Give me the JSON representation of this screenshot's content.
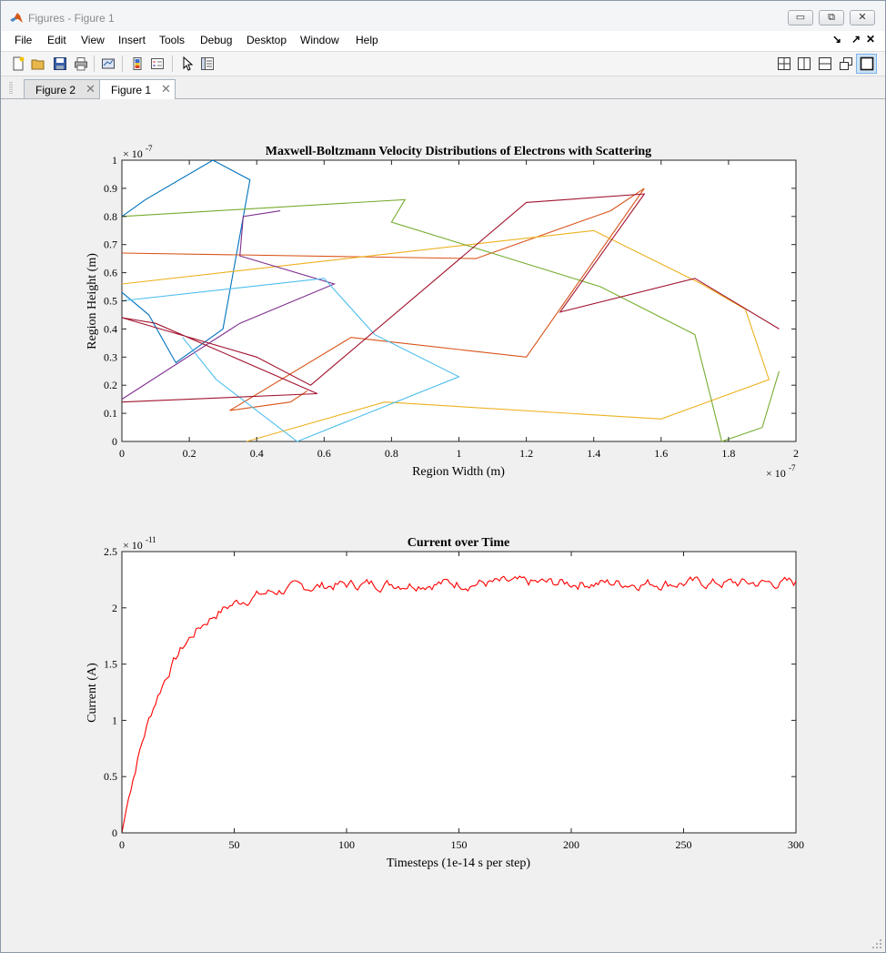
{
  "window": {
    "title": "Figures - Figure 1",
    "controls": {
      "minimize": "▭",
      "restore": "⧉",
      "close": "✕"
    }
  },
  "menu": {
    "items": [
      "File",
      "Edit",
      "View",
      "Insert",
      "Tools",
      "Debug",
      "Desktop",
      "Window",
      "Help"
    ],
    "right": [
      "↘",
      "↗",
      "✕"
    ]
  },
  "toolbar": {
    "icons": [
      "new-figure-icon",
      "open-file-icon",
      "save-icon",
      "print-icon",
      "link-plot-icon",
      "insert-colorbar-icon",
      "insert-legend-icon",
      "select-pointer-icon",
      "property-inspector-icon"
    ],
    "layout_icons": [
      "tile-grid-icon",
      "left-right-split-icon",
      "top-bottom-split-icon",
      "float-icon",
      "maximize-icon"
    ]
  },
  "tabs": [
    {
      "label": "Figure 2",
      "active": false
    },
    {
      "label": "Figure 1",
      "active": true
    }
  ],
  "colors": {
    "series": [
      "#0072BD",
      "#D95319",
      "#EDB120",
      "#7E2F8E",
      "#77AC30",
      "#4DBEEE",
      "#A2142F"
    ],
    "current_line": "#ff0000"
  },
  "chart_data": [
    {
      "type": "line",
      "title": "Maxwell-Boltzmann Velocity Distributions of Electrons with Scattering",
      "xlabel": "Region Width (m)",
      "ylabel": "Region Height (m)",
      "xlim": [
        0,
        2e-07
      ],
      "ylim": [
        0,
        1e-07
      ],
      "x_ticks": [
        "0",
        "0.2",
        "0.4",
        "0.6",
        "0.8",
        "1",
        "1.2",
        "1.4",
        "1.6",
        "1.8",
        "2"
      ],
      "y_ticks": [
        "0",
        "0.1",
        "0.2",
        "0.3",
        "0.4",
        "0.5",
        "0.6",
        "0.7",
        "0.8",
        "0.9",
        "1"
      ],
      "x_exponent": "-7",
      "y_exponent": "-7",
      "exponent_base": "× 10",
      "series": [
        {
          "values": [
            [
              0.0,
              0.8
            ],
            [
              0.07,
              0.86
            ],
            [
              0.27,
              1.0
            ],
            [
              0.38,
              0.93
            ],
            [
              0.3,
              0.4
            ],
            [
              0.16,
              0.28
            ],
            [
              0.08,
              0.45
            ],
            [
              0.0,
              0.53
            ]
          ]
        },
        {
          "values": [
            [
              0.0,
              0.67
            ],
            [
              1.05,
              0.65
            ],
            [
              1.45,
              0.82
            ],
            [
              1.55,
              0.9
            ],
            [
              1.2,
              0.3
            ],
            [
              0.68,
              0.37
            ],
            [
              0.32,
              0.11
            ],
            [
              0.5,
              0.14
            ],
            [
              0.55,
              0.18
            ]
          ]
        },
        {
          "values": [
            [
              0.0,
              0.56
            ],
            [
              1.4,
              0.75
            ],
            [
              1.72,
              0.56
            ],
            [
              1.85,
              0.47
            ],
            [
              1.92,
              0.22
            ],
            [
              1.6,
              0.08
            ],
            [
              0.78,
              0.14
            ],
            [
              0.37,
              0.0
            ]
          ]
        },
        {
          "values": [
            [
              0.0,
              0.15
            ],
            [
              0.35,
              0.42
            ],
            [
              0.63,
              0.56
            ],
            [
              0.35,
              0.66
            ],
            [
              0.36,
              0.8
            ],
            [
              0.47,
              0.82
            ]
          ]
        },
        {
          "values": [
            [
              0.0,
              0.8
            ],
            [
              0.84,
              0.86
            ],
            [
              0.8,
              0.78
            ],
            [
              1.42,
              0.55
            ],
            [
              1.7,
              0.38
            ],
            [
              1.78,
              0.0
            ],
            [
              1.9,
              0.05
            ],
            [
              1.95,
              0.25
            ]
          ]
        },
        {
          "values": [
            [
              0.0,
              0.5
            ],
            [
              0.6,
              0.58
            ],
            [
              0.75,
              0.38
            ],
            [
              1.0,
              0.23
            ],
            [
              0.52,
              0.0
            ],
            [
              0.28,
              0.22
            ],
            [
              0.18,
              0.37
            ]
          ]
        },
        {
          "values": [
            [
              0.0,
              0.14
            ],
            [
              0.58,
              0.17
            ],
            [
              0.1,
              0.42
            ],
            [
              0.0,
              0.44
            ],
            [
              0.4,
              0.3
            ],
            [
              0.56,
              0.2
            ],
            [
              1.2,
              0.85
            ],
            [
              1.55,
              0.88
            ],
            [
              1.3,
              0.46
            ],
            [
              1.7,
              0.58
            ],
            [
              1.95,
              0.4
            ]
          ]
        }
      ]
    },
    {
      "type": "line",
      "title": "Current over Time",
      "xlabel": "Timesteps (1e-14 s per step)",
      "ylabel": "Current (A)",
      "xlim": [
        0,
        300
      ],
      "ylim": [
        0,
        2.5e-11
      ],
      "x_ticks": [
        "0",
        "50",
        "100",
        "150",
        "200",
        "250",
        "300"
      ],
      "y_ticks": [
        "0",
        "0.5",
        "1",
        "1.5",
        "2",
        "2.5"
      ],
      "y_exponent": "-11",
      "exponent_base": "× 10",
      "asymptote": 2.22,
      "time_constant": 20,
      "noise_amplitude": 0.04
    }
  ]
}
